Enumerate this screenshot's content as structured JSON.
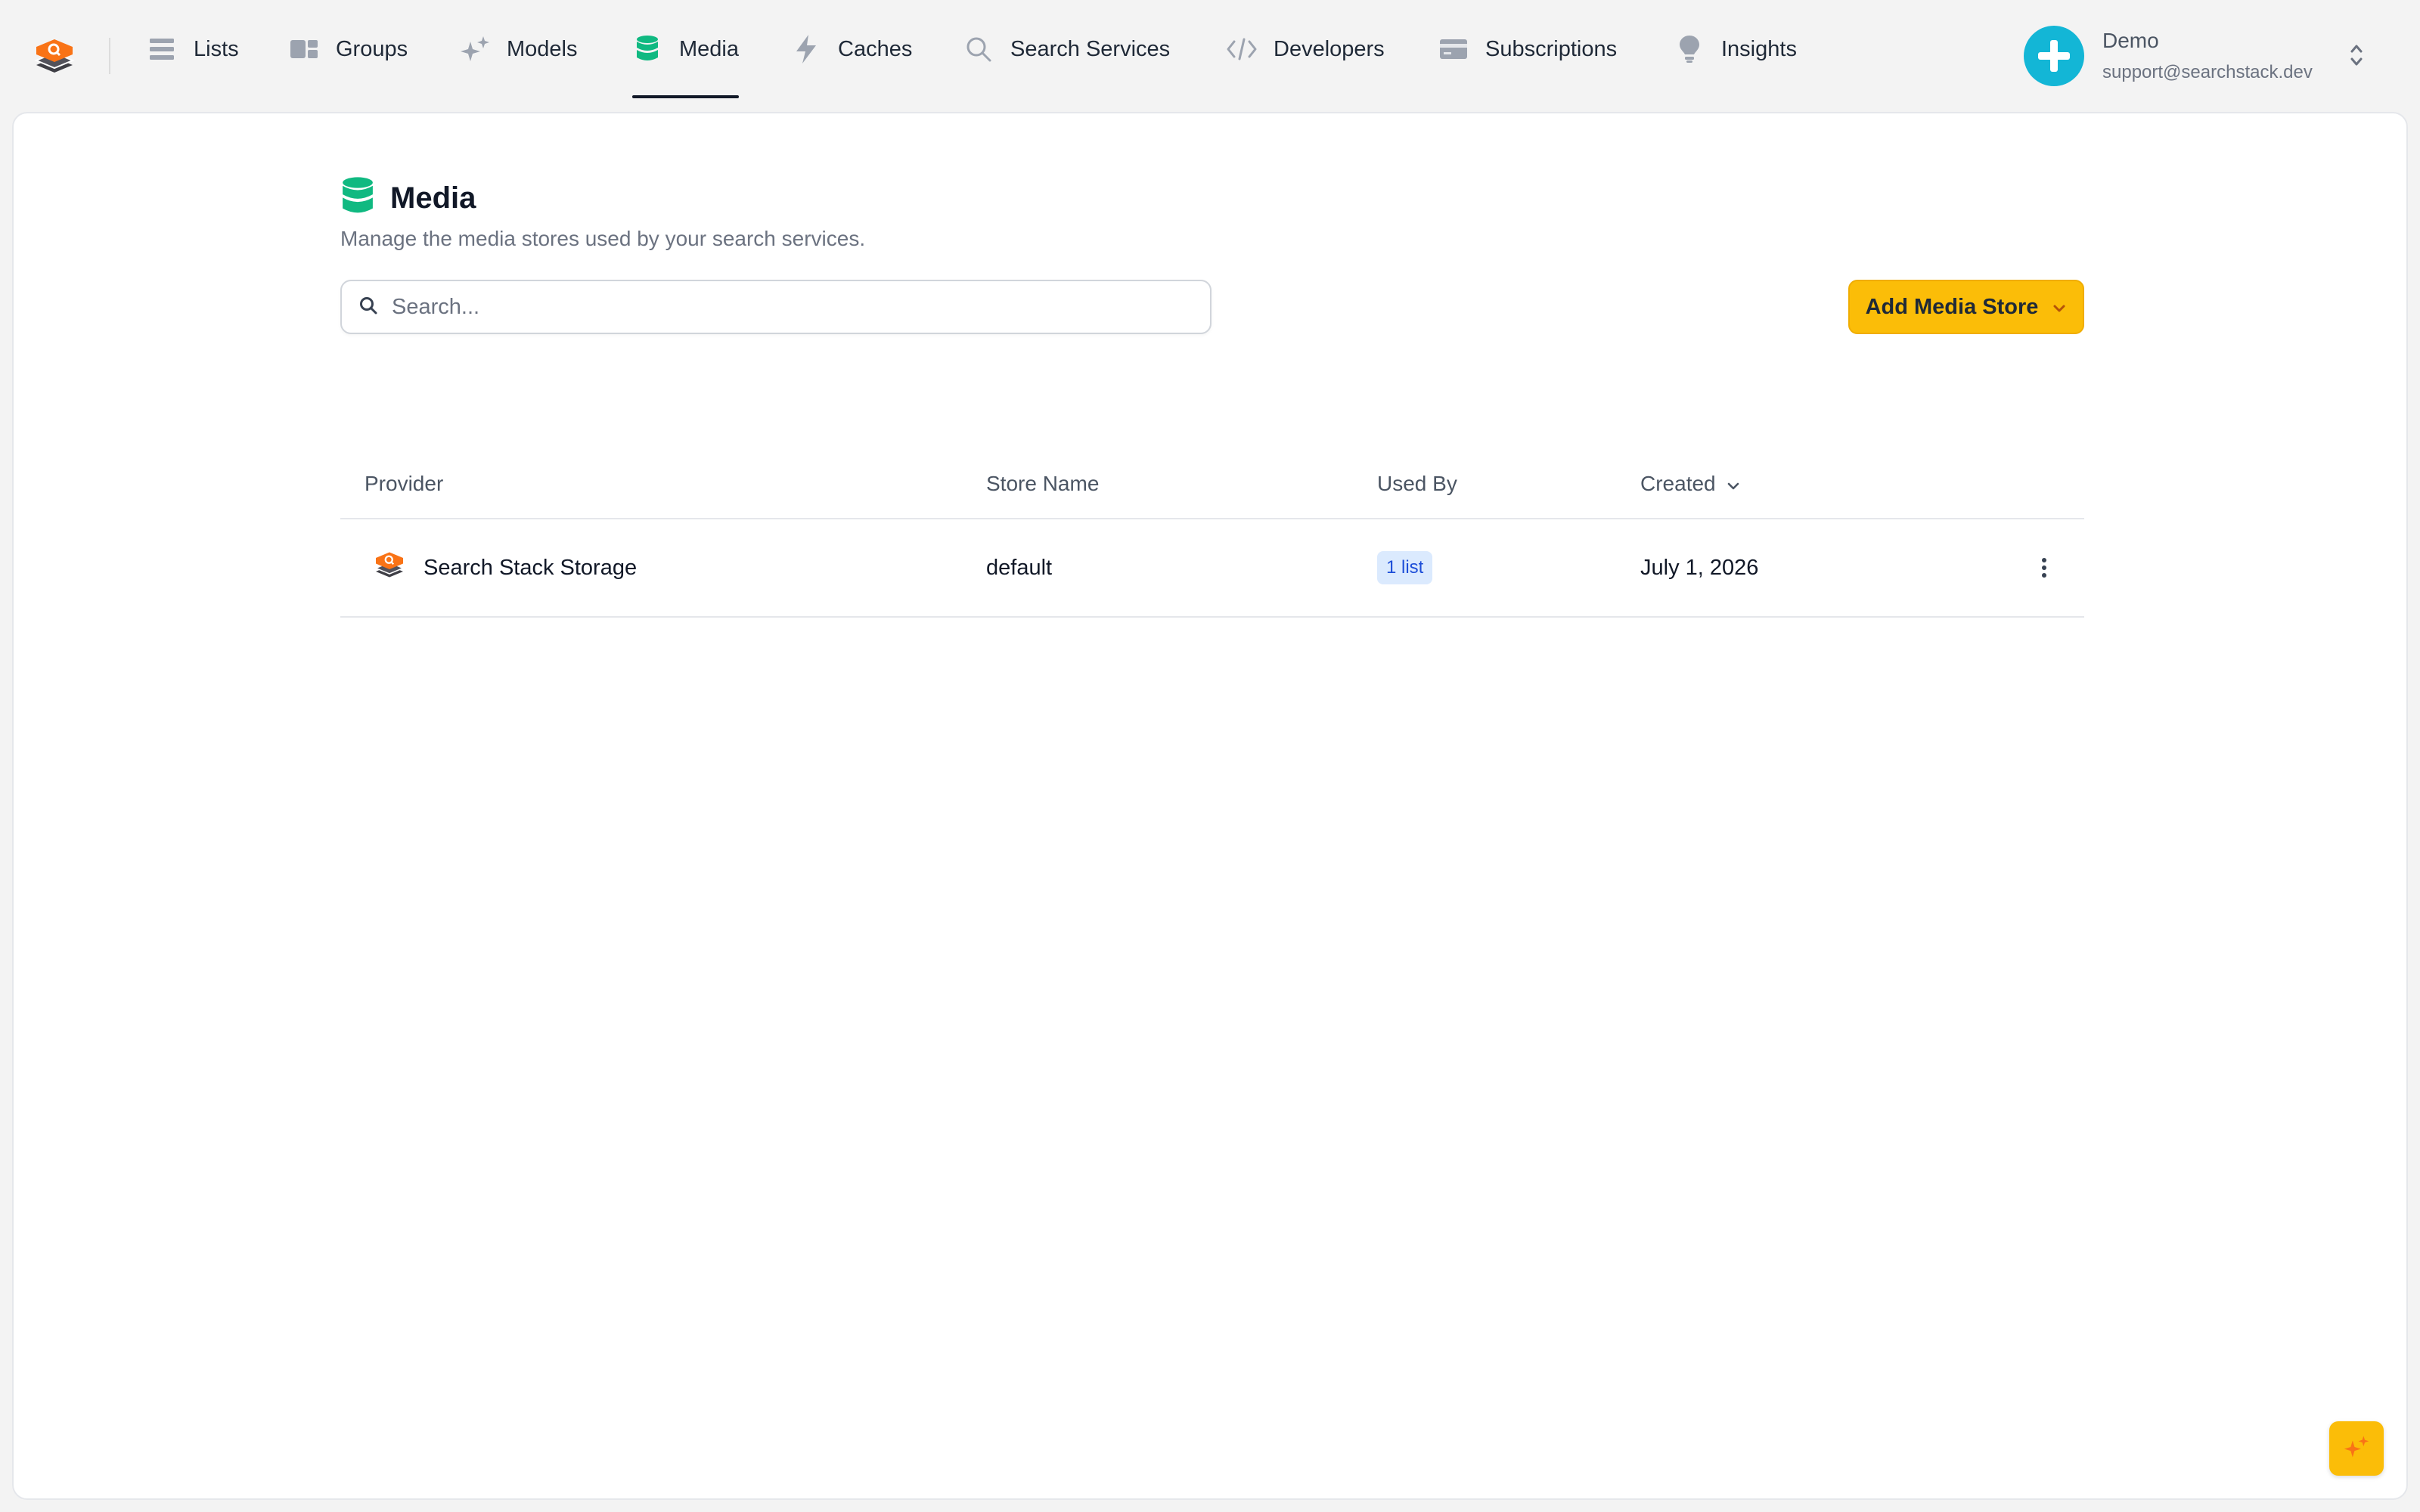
{
  "nav": {
    "items": [
      {
        "label": "Lists",
        "icon": "list-icon"
      },
      {
        "label": "Groups",
        "icon": "groups-icon"
      },
      {
        "label": "Models",
        "icon": "sparkles-icon"
      },
      {
        "label": "Media",
        "icon": "database-icon",
        "active": true
      },
      {
        "label": "Caches",
        "icon": "bolt-icon"
      },
      {
        "label": "Search Services",
        "icon": "search-icon"
      },
      {
        "label": "Developers",
        "icon": "code-icon"
      },
      {
        "label": "Subscriptions",
        "icon": "credit-card-icon"
      },
      {
        "label": "Insights",
        "icon": "lightbulb-icon"
      }
    ]
  },
  "account": {
    "name": "Demo",
    "email": "support@searchstack.dev",
    "avatar_color": "#13b6d6"
  },
  "page": {
    "title": "Media",
    "subtitle": "Manage the media stores used by your search services.",
    "search_placeholder": "Search...",
    "add_button_label": "Add Media Store"
  },
  "table": {
    "headers": {
      "provider": "Provider",
      "store_name": "Store Name",
      "used_by": "Used By",
      "created": "Created"
    },
    "rows": [
      {
        "provider": "Search Stack Storage",
        "store_name": "default",
        "used_by": "1 list",
        "created": "July 1, 2026"
      }
    ]
  },
  "colors": {
    "accent": "#fbbd08",
    "media_icon": "#10b981",
    "brand_orange": "#f97316",
    "badge_bg": "#dbeafe",
    "badge_text": "#1d4ed8"
  }
}
